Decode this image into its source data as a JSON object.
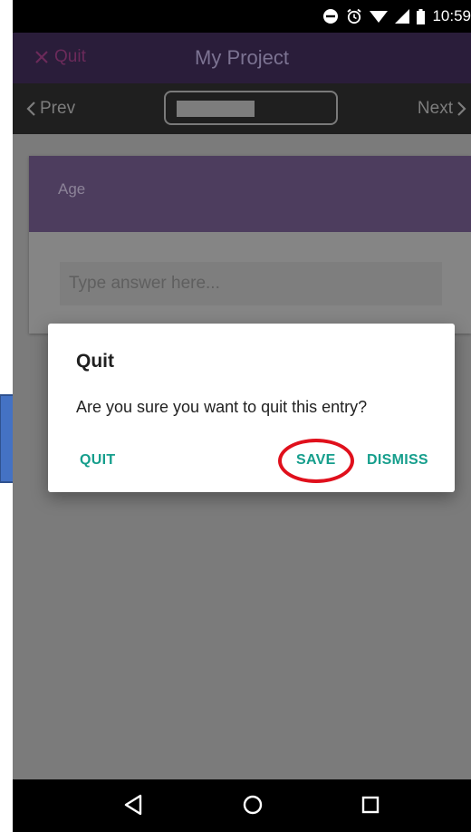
{
  "status_bar": {
    "time": "10:59",
    "icons": [
      "do-not-disturb-icon",
      "alarm-icon",
      "wifi-icon",
      "cell-signal-icon",
      "battery-icon"
    ]
  },
  "app_bar": {
    "quit_label": "Quit",
    "title": "My Project"
  },
  "nav_bar": {
    "prev_label": "Prev",
    "next_label": "Next"
  },
  "question": {
    "label": "Age",
    "placeholder": "Type answer here..."
  },
  "dialog": {
    "title": "Quit",
    "message": "Are you sure you want to quit this entry?",
    "quit_button": "QUIT",
    "save_button": "SAVE",
    "dismiss_button": "DISMISS"
  },
  "annotation": {
    "highlight": "save-button",
    "highlight_color": "#e0101c",
    "arrow_color": "#4472c4"
  },
  "colors": {
    "accent": "#159e8c",
    "app_bar": "#2a1d3a"
  },
  "system_nav": [
    "back-icon",
    "home-icon",
    "recents-icon"
  ]
}
